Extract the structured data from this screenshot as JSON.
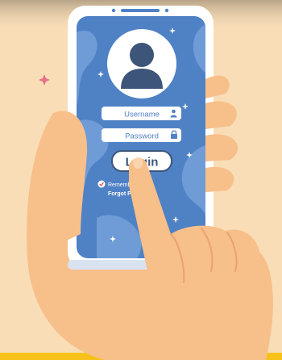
{
  "login_form": {
    "username_placeholder": "Username",
    "password_placeholder": "Password",
    "login_label": "Login",
    "remember_label": "Remember",
    "remember_checked": true,
    "forgot_label": "Forgot Pa"
  },
  "colors": {
    "background": "#f8ddb6",
    "top_shadow": "#b8a488",
    "screen_blue": "#4f81c5",
    "screen_blue_light": "#6f9bd6",
    "phone_frame": "#ffffff",
    "skin": "#f7bf8a",
    "skin_dark": "#eaa36f",
    "accent_yellow": "#f6c21a",
    "sparkle_pink": "#e8708a",
    "avatar_silhouette": "#3d5579"
  },
  "icons": {
    "avatar": "user-silhouette-icon",
    "username_field": "user-icon",
    "password_field": "lock-icon",
    "remember_checkbox": "check-icon"
  }
}
